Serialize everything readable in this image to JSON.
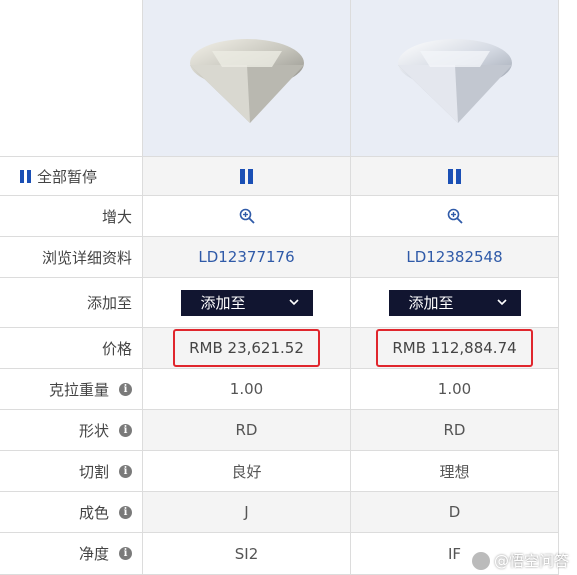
{
  "toolbar": {
    "pause_all": "全部暂停"
  },
  "labels": {
    "enlarge": "增大",
    "details": "浏览详细资料",
    "add_to": "添加至",
    "price": "价格",
    "carat": "克拉重量",
    "shape": "形状",
    "cut": "切割",
    "color": "成色",
    "clarity": "净度"
  },
  "diamonds": [
    {
      "id": "LD12377176",
      "add_label": "添加至",
      "price": "RMB 23,621.52",
      "carat": "1.00",
      "shape": "RD",
      "cut": "良好",
      "color": "J",
      "clarity": "SI2"
    },
    {
      "id": "LD12382548",
      "add_label": "添加至",
      "price": "RMB 112,884.74",
      "carat": "1.00",
      "shape": "RD",
      "cut": "理想",
      "color": "D",
      "clarity": "IF"
    }
  ],
  "watermark": "@悟空问答",
  "colors": {
    "link": "#2f5aa8",
    "highlight": "#e0262d",
    "button_bg": "#111530",
    "pause": "#1a4fb5"
  }
}
